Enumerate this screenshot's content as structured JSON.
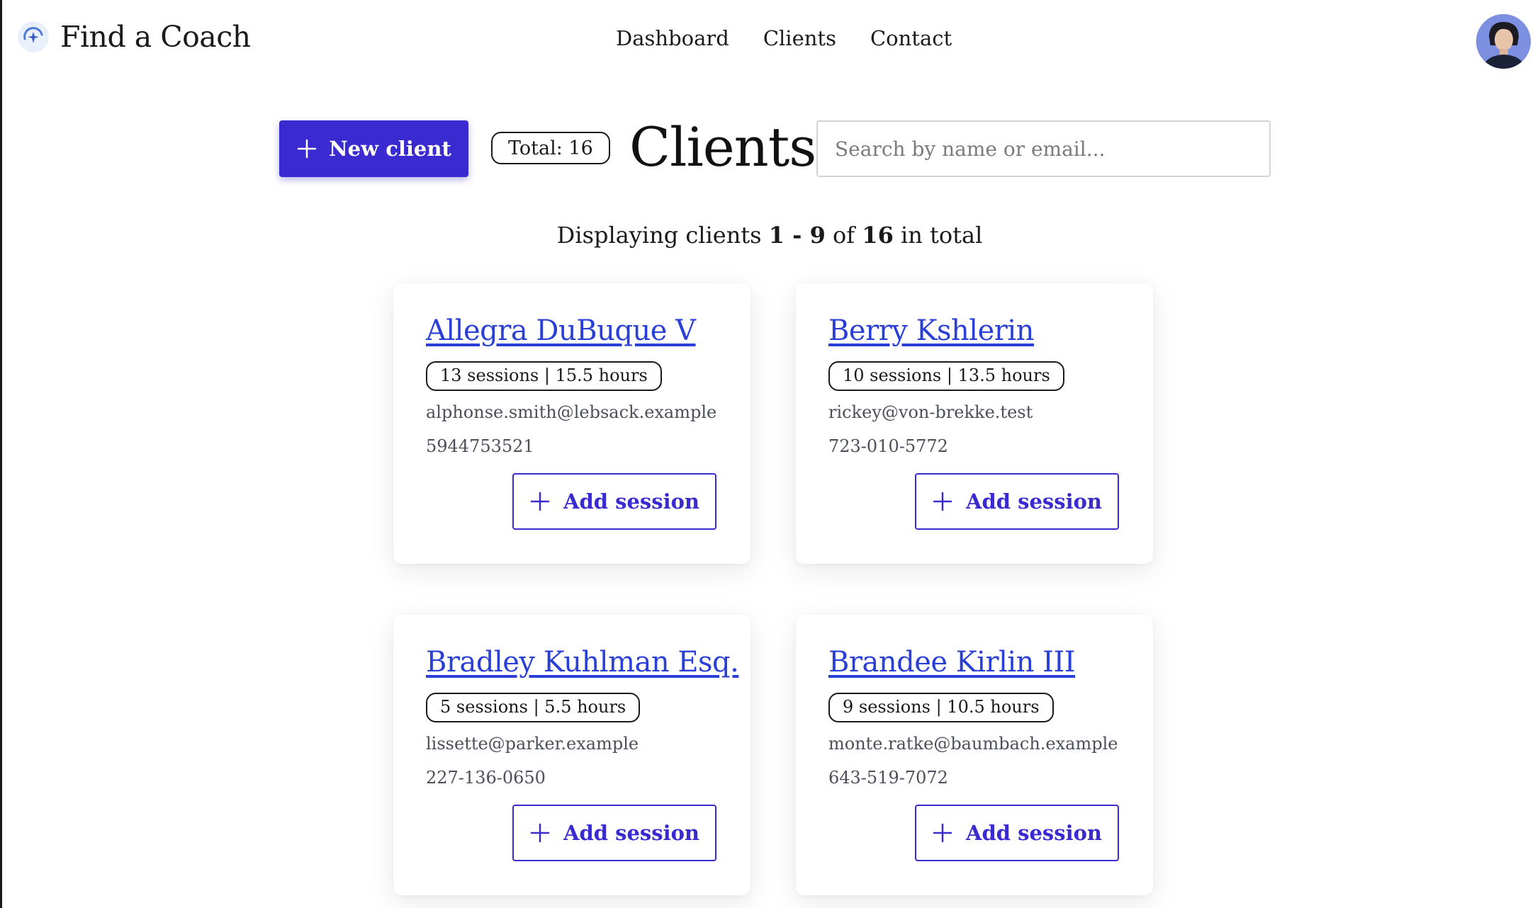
{
  "app": {
    "name": "Find a Coach"
  },
  "nav": {
    "items": [
      {
        "label": "Dashboard"
      },
      {
        "label": "Clients"
      },
      {
        "label": "Contact"
      }
    ]
  },
  "toolbar": {
    "new_client_label": "New client",
    "total_label": "Total: 16",
    "title": "Clients",
    "search_placeholder": "Search by name or email..."
  },
  "summary": {
    "prefix": "Displaying clients",
    "range": "1 - 9",
    "of": "of",
    "total": "16",
    "suffix": "in total"
  },
  "clients": [
    {
      "name": "Allegra DuBuque V",
      "stats": "13 sessions | 15.5 hours",
      "email": "alphonse.smith@lebsack.example",
      "phone": "5944753521",
      "action_label": "Add session"
    },
    {
      "name": "Berry Kshlerin",
      "stats": "10 sessions | 13.5 hours",
      "email": "rickey@von-brekke.test",
      "phone": "723-010-5772",
      "action_label": "Add session"
    },
    {
      "name": "Bradley Kuhlman Esq.",
      "stats": "5 sessions | 5.5 hours",
      "email": "lissette@parker.example",
      "phone": "227-136-0650",
      "action_label": "Add session"
    },
    {
      "name": "Brandee Kirlin III",
      "stats": "9 sessions | 10.5 hours",
      "email": "monte.ratke@baumbach.example",
      "phone": "643-519-7072",
      "action_label": "Add session"
    }
  ],
  "colors": {
    "accent": "#3a2bd1",
    "link": "#2a3fd6",
    "text": "#1a1a1a",
    "muted": "#4a4f5a"
  }
}
